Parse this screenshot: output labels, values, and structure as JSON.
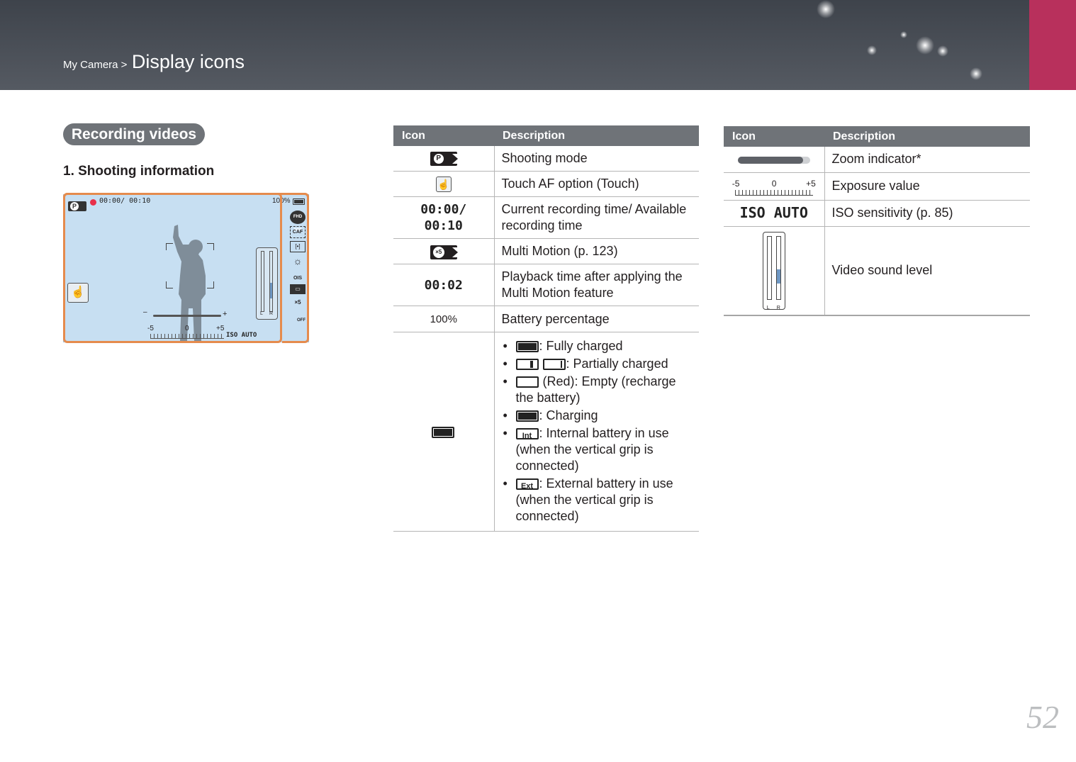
{
  "header": {
    "breadcrumb": "My Camera >",
    "title": "Display icons",
    "accent_color": "#b8305c"
  },
  "section": {
    "title": "Recording videos",
    "subtitle": "1. Shooting information"
  },
  "screen": {
    "rec_time": "00:00/ 00:10",
    "battery": "100%",
    "ev_minus": "-5",
    "ev_zero": "0",
    "ev_plus": "+5",
    "iso": "ISO AUTO",
    "zoom_minus": "–",
    "zoom_plus": "+",
    "right_icons": [
      "FHD 30P",
      "CAF",
      "[•]",
      "☼",
      "OIS",
      "▭",
      "×5",
      "OFF"
    ],
    "level_left": "L",
    "level_right": "R"
  },
  "table1": {
    "headers": [
      "Icon",
      "Description"
    ],
    "rows": [
      {
        "icon": "P-movie-icon",
        "desc": "Shooting mode"
      },
      {
        "icon": "touch-af-icon",
        "desc": "Touch AF option (Touch)"
      },
      {
        "icon_text": "00:00/ 00:10",
        "desc": "Current recording time/ Available recording time"
      },
      {
        "icon": "multi-motion-icon",
        "desc": "Multi Motion (p. 123)"
      },
      {
        "icon_text": "00:02",
        "desc": "Playback time after applying the Multi Motion feature"
      },
      {
        "icon_text": "100%",
        "desc": "Battery percentage"
      }
    ],
    "battery_items": [
      ": Fully charged",
      ": Partially charged",
      " (Red): Empty (recharge the battery)",
      ": Charging",
      ": Internal battery in use (when the vertical grip is connected)",
      ": External battery in use (when the vertical grip is connected)"
    ],
    "int_label": "Int",
    "ext_label": "Ext"
  },
  "table2": {
    "headers": [
      "Icon",
      "Description"
    ],
    "rows": [
      {
        "icon": "zoom-indicator-icon",
        "desc": "Zoom indicator*"
      },
      {
        "ev_minus": "-5",
        "ev_zero": "0",
        "ev_plus": "+5",
        "desc": "Exposure value"
      },
      {
        "icon_text": "ISO AUTO",
        "desc": "ISO sensitivity (p. 85)"
      },
      {
        "icon": "sound-level-icon",
        "desc": "Video sound level",
        "left": "L",
        "right": "R"
      }
    ]
  },
  "page_number": "52"
}
